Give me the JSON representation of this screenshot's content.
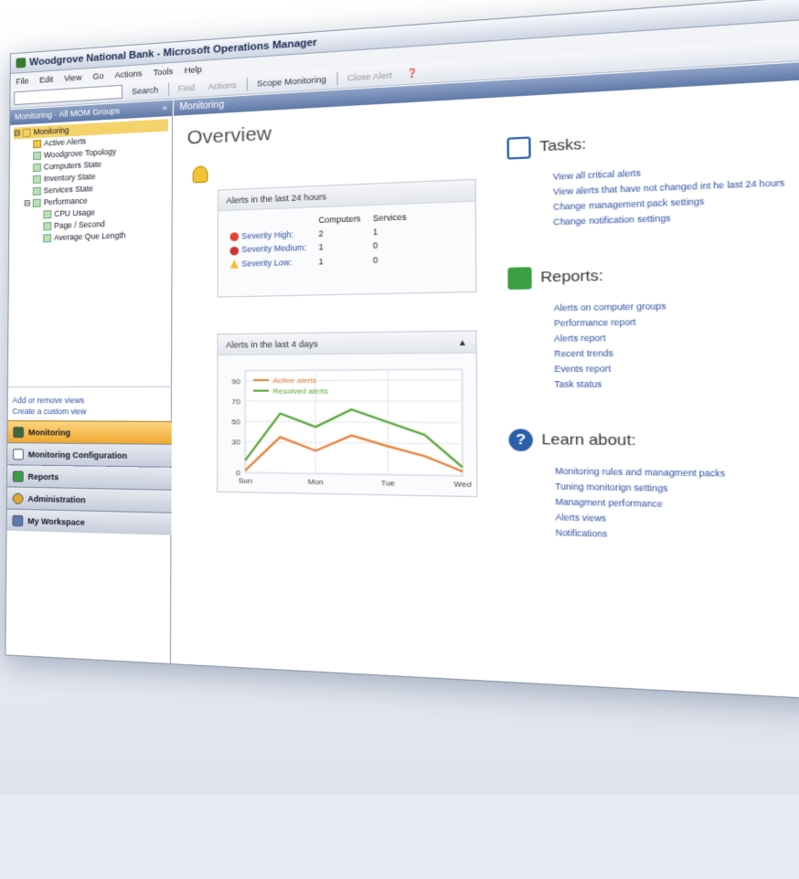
{
  "window": {
    "title": "Woodgrove National Bank - Microsoft Operations Manager"
  },
  "menu": [
    "File",
    "Edit",
    "View",
    "Go",
    "Actions",
    "Tools",
    "Help"
  ],
  "toolbar": {
    "search": "Search",
    "scope": "Scope Monitoring",
    "items": [
      "Find",
      "Actions",
      "Close Alert"
    ]
  },
  "left": {
    "header": "Monitoring",
    "group": "All MOM Groups",
    "tree": [
      "Monitoring",
      "Active Alerts",
      "Woodgrove Topology",
      "Computers State",
      "Inventory State",
      "Services State",
      "Performance",
      "CPU Usage",
      "Page / Second",
      "Average Que Length"
    ],
    "links": [
      "Add or remove views",
      "Create a custom view"
    ],
    "wunderbar": [
      "Monitoring",
      "Monitoring Configuration",
      "Reports",
      "Administration",
      "My Workspace"
    ]
  },
  "main": {
    "header": "Monitoring",
    "title": "Overview",
    "alerts24": {
      "title": "Alerts in the last 24 hours",
      "cols": [
        "Computers",
        "Services"
      ],
      "rows": [
        {
          "label": "Severity High:",
          "computers": "2",
          "services": "1"
        },
        {
          "label": "Severity Medium:",
          "computers": "1",
          "services": "0"
        },
        {
          "label": "Severity Low:",
          "computers": "1",
          "services": "0"
        }
      ]
    },
    "alerts4_title": "Alerts in the last 4 days",
    "tasks": {
      "title": "Tasks:",
      "items": [
        "View all critical alerts",
        "View alerts that have not changed int he last 24 hours",
        "Change management pack settings",
        "Change notification settings"
      ]
    },
    "reports": {
      "title": "Reports:",
      "items": [
        "Alerts on computer groups",
        "Performance report",
        "Alerts report",
        "Recent trends",
        "Events report",
        "Task status"
      ]
    },
    "learn": {
      "title": "Learn about:",
      "items": [
        "Monitoring rules and managment packs",
        "Tuning monitorign settings",
        "Managment performance",
        "Alerts views",
        "Notifications"
      ]
    }
  },
  "chart_data": {
    "type": "line",
    "title": "Alerts in the last 4 days",
    "categories": [
      "Sun",
      "Mon",
      "Tue",
      "Wed"
    ],
    "x": [
      0,
      0.5,
      1,
      1.5,
      2,
      2.5,
      3,
      3.5
    ],
    "series": [
      {
        "name": "Active alerts",
        "color": "#e8823a",
        "values": [
          2,
          35,
          22,
          37,
          27,
          18,
          4
        ]
      },
      {
        "name": "Resolved alerts",
        "color": "#5aa83a",
        "values": [
          12,
          58,
          45,
          62,
          50,
          38,
          8
        ]
      }
    ],
    "yticks": [
      0,
      30,
      50,
      70,
      90
    ],
    "ylim": [
      0,
      100
    ]
  },
  "colors": {
    "accent": "#2b4fa0",
    "selected": "#f0a830"
  }
}
